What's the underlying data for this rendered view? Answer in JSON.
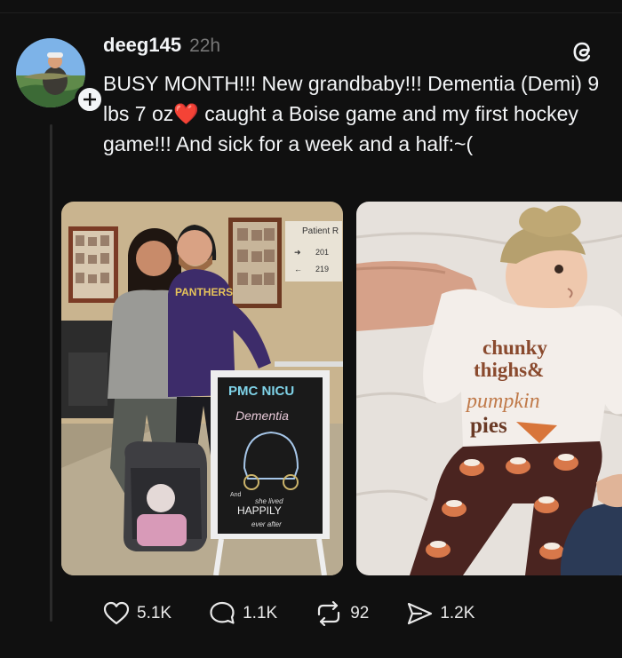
{
  "post": {
    "username": "deeg145",
    "time": "22h",
    "text": "BUSY MONTH!!! New grandbaby!!! Dementia (Demi) 9 lbs 7 oz❤️ caught a Boise game and my first hockey game!!! And sick for a week and a half:~("
  },
  "photo_left": {
    "sign_title": "Patient R",
    "sign_room_1": "201",
    "sign_room_2": "219",
    "sweatshirt": "PANTHERS",
    "board_title": "PMC NICU",
    "board_name": "Dementia",
    "board_line_1": "And",
    "board_line_2": "she lived",
    "board_line_3": "HAPPILY",
    "board_line_4": "ever after"
  },
  "photo_right": {
    "onesie_line_1": "chunky",
    "onesie_line_2": "thighs&",
    "onesie_line_3": "pumpkin",
    "onesie_line_4": "pies"
  },
  "actions": {
    "likes": "5.1K",
    "replies": "1.1K",
    "reposts": "92",
    "shares": "1.2K"
  },
  "colors": {
    "background": "#101010",
    "text": "#f3f5f7",
    "muted": "#777777",
    "heart": "#e0302f"
  }
}
